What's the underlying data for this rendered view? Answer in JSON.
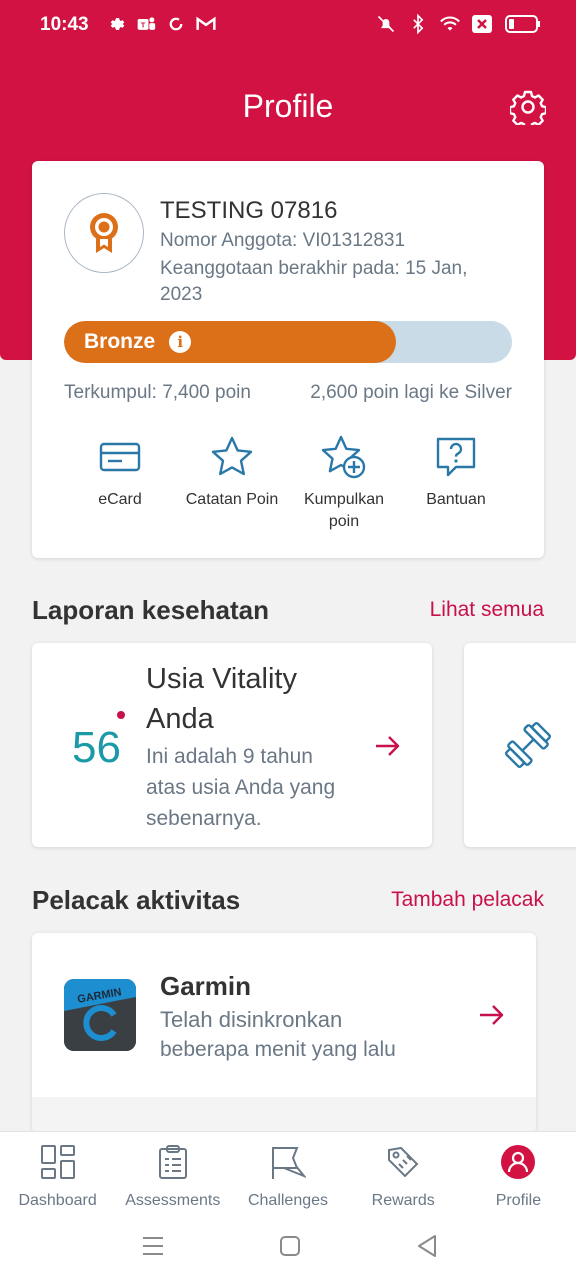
{
  "statusbar": {
    "time": "10:43",
    "icons_left": [
      "gear-icon",
      "teams-icon",
      "sync-icon",
      "gmail-icon"
    ],
    "icons_right": [
      "mute-icon",
      "bluetooth-icon",
      "wifi-icon",
      "sim-icon",
      "battery-icon"
    ]
  },
  "header": {
    "title": "Profile"
  },
  "profile": {
    "name": "TESTING 07816",
    "member_number": "Nomor Anggota: VI01312831",
    "membership_expiry": "Keanggotaan berakhir pada: 15 Jan, 2023",
    "tier": "Bronze",
    "tier_progress": 0.74,
    "points_collected": "Terkumpul: 7,400 poin",
    "points_to_next": "2,600 poin lagi ke Silver",
    "colors": {
      "tier_bar": "#dc7019",
      "track": "#c8dbe6"
    }
  },
  "actions": [
    {
      "label": "eCard",
      "icon": "card-icon"
    },
    {
      "label": "Catatan Poin",
      "icon": "star-icon"
    },
    {
      "label": "Kumpulkan poin",
      "icon": "star-plus-icon"
    },
    {
      "label": "Bantuan",
      "icon": "help-chat-icon"
    }
  ],
  "health": {
    "title": "Laporan kesehatan",
    "link": "Lihat semua",
    "card": {
      "value": "56",
      "title": "Usia Vitality Anda",
      "description": "Ini adalah 9 tahun atas usia Anda yang sebenarnya."
    }
  },
  "tracker": {
    "title": "Pelacak aktivitas",
    "link": "Tambah pelacak",
    "device": {
      "name": "Garmin",
      "status": "Telah disinkronkan",
      "time": "beberapa menit yang lalu",
      "logo_text": "GARMIN"
    }
  },
  "nav": [
    {
      "label": "Dashboard",
      "icon": "dashboard-icon"
    },
    {
      "label": "Assessments",
      "icon": "clipboard-icon"
    },
    {
      "label": "Challenges",
      "icon": "flag-icon"
    },
    {
      "label": "Rewards",
      "icon": "tag-icon"
    },
    {
      "label": "Profile",
      "icon": "user-icon",
      "active": true
    }
  ],
  "colors": {
    "brand": "#d21242",
    "link": "#c8104a",
    "teal": "#1a9aa8",
    "icon_blue": "#2a78a8"
  }
}
